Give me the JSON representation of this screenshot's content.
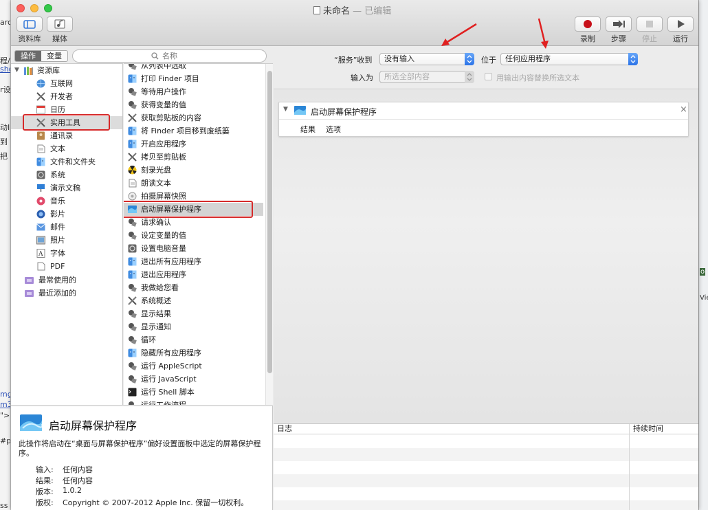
{
  "background_app": {
    "left_fragments": [
      "arc",
      "程/",
      "sho",
      "r设",
      "动I",
      "到",
      "把",
      "mg",
      "m3",
      "\">",
      "#p",
      "ss"
    ],
    "right_fragments": [
      "o",
      "Vie"
    ]
  },
  "window": {
    "title": "未命名",
    "title_suffix": "— 已编辑"
  },
  "toolbar": {
    "library_label": "资料库",
    "media_label": "媒体",
    "record_label": "录制",
    "step_label": "步骤",
    "stop_label": "停止",
    "run_label": "运行"
  },
  "tabs": {
    "actions_label": "操作",
    "variables_label": "变量"
  },
  "search": {
    "placeholder": "名称",
    "value": ""
  },
  "library": {
    "root_label": "资源库",
    "items": [
      {
        "label": "互联网",
        "icon": "globe-icon"
      },
      {
        "label": "开发者",
        "icon": "tools-icon"
      },
      {
        "label": "日历",
        "icon": "calendar-icon"
      },
      {
        "label": "实用工具",
        "icon": "utilities-icon"
      },
      {
        "label": "通讯录",
        "icon": "contacts-icon"
      },
      {
        "label": "文本",
        "icon": "text-icon"
      },
      {
        "label": "文件和文件夹",
        "icon": "finder-icon"
      },
      {
        "label": "系统",
        "icon": "system-icon"
      },
      {
        "label": "演示文稿",
        "icon": "presentation-icon"
      },
      {
        "label": "音乐",
        "icon": "music-icon"
      },
      {
        "label": "影片",
        "icon": "movie-icon"
      },
      {
        "label": "邮件",
        "icon": "mail-icon"
      },
      {
        "label": "照片",
        "icon": "photo-icon"
      },
      {
        "label": "字体",
        "icon": "font-icon"
      },
      {
        "label": "PDF",
        "icon": "pdf-icon"
      }
    ],
    "recent_used": "最常使用的",
    "recent_added": "最近添加的"
  },
  "actions": [
    {
      "label": "从列表中选取",
      "icon": "automator-icon"
    },
    {
      "label": "打印 Finder 项目",
      "icon": "finder-icon"
    },
    {
      "label": "等待用户操作",
      "icon": "automator-icon"
    },
    {
      "label": "获得变量的值",
      "icon": "automator-icon"
    },
    {
      "label": "获取剪贴板的内容",
      "icon": "tools-icon"
    },
    {
      "label": "将 Finder 项目移到废纸篓",
      "icon": "finder-icon"
    },
    {
      "label": "开启应用程序",
      "icon": "finder-icon"
    },
    {
      "label": "拷贝至剪贴板",
      "icon": "tools-icon"
    },
    {
      "label": "刻录光盘",
      "icon": "burn-icon"
    },
    {
      "label": "朗读文本",
      "icon": "text-icon"
    },
    {
      "label": "拍摄屏幕快照",
      "icon": "screenshot-icon"
    },
    {
      "label": "启动屏幕保护程序",
      "icon": "screensaver-icon"
    },
    {
      "label": "请求确认",
      "icon": "automator-icon"
    },
    {
      "label": "设定变量的值",
      "icon": "automator-icon"
    },
    {
      "label": "设置电脑音量",
      "icon": "system-icon"
    },
    {
      "label": "退出所有应用程序",
      "icon": "finder-icon"
    },
    {
      "label": "退出应用程序",
      "icon": "finder-icon"
    },
    {
      "label": "我做给您看",
      "icon": "automator-icon"
    },
    {
      "label": "系统概述",
      "icon": "tools-icon"
    },
    {
      "label": "显示结果",
      "icon": "automator-icon"
    },
    {
      "label": "显示通知",
      "icon": "automator-icon"
    },
    {
      "label": "循环",
      "icon": "automator-icon"
    },
    {
      "label": "隐藏所有应用程序",
      "icon": "finder-icon"
    },
    {
      "label": "运行 AppleScript",
      "icon": "automator-icon"
    },
    {
      "label": "运行 JavaScript",
      "icon": "automator-icon"
    },
    {
      "label": "运行 Shell 脚本",
      "icon": "terminal-icon"
    },
    {
      "label": "运行工作流程",
      "icon": "automator-icon"
    }
  ],
  "description": {
    "title": "启动屏幕保护程序",
    "text": "此操作将启动在“桌面与屏幕保护程序”偏好设置面板中选定的屏幕保护程序。",
    "input_key": "输入:",
    "input_val": "任何内容",
    "result_key": "结果:",
    "result_val": "任何内容",
    "version_key": "版本:",
    "version_val": "1.0.2",
    "copyright_key": "版权:",
    "copyright_val": "Copyright © 2007-2012 Apple Inc.  保留一切权利。"
  },
  "service": {
    "receives_label": "“服务”收到",
    "receives_value": "没有输入",
    "in_label": "位于",
    "in_value": "任何应用程序",
    "input_is_label": "输入为",
    "input_is_value": "所选全部内容",
    "replace_label": "用输出内容替换所选文本"
  },
  "workflow_action": {
    "title": "启动屏幕保护程序",
    "results_label": "结果",
    "options_label": "选项",
    "close": "×"
  },
  "log": {
    "log_col": "日志",
    "duration_col": "持续时间"
  }
}
